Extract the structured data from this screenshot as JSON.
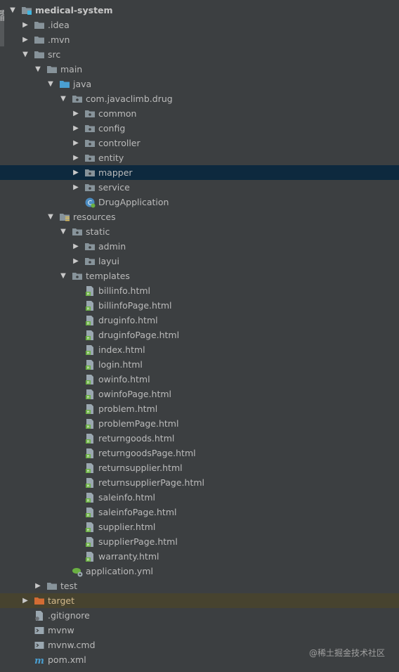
{
  "side_tab": "项目",
  "watermark": "@稀土掘金技术社区",
  "colors": {
    "background": "#3c3f41",
    "selected_row": "#0d293e",
    "excluded_row": "#47432f"
  },
  "tree": [
    {
      "label": "medical-system",
      "depth": 0,
      "arrow": "open",
      "icon": "module-folder-icon",
      "bold": true
    },
    {
      "label": ".idea",
      "depth": 1,
      "arrow": "closed",
      "icon": "folder-icon"
    },
    {
      "label": ".mvn",
      "depth": 1,
      "arrow": "closed",
      "icon": "folder-icon"
    },
    {
      "label": "src",
      "depth": 1,
      "arrow": "open",
      "icon": "folder-icon"
    },
    {
      "label": "main",
      "depth": 2,
      "arrow": "open",
      "icon": "folder-icon"
    },
    {
      "label": "java",
      "depth": 3,
      "arrow": "open",
      "icon": "source-folder-icon"
    },
    {
      "label": "com.javaclimb.drug",
      "depth": 4,
      "arrow": "open",
      "icon": "package-icon"
    },
    {
      "label": "common",
      "depth": 5,
      "arrow": "closed",
      "icon": "package-icon"
    },
    {
      "label": "config",
      "depth": 5,
      "arrow": "closed",
      "icon": "package-icon"
    },
    {
      "label": "controller",
      "depth": 5,
      "arrow": "closed",
      "icon": "package-icon"
    },
    {
      "label": "entity",
      "depth": 5,
      "arrow": "closed",
      "icon": "package-icon"
    },
    {
      "label": "mapper",
      "depth": 5,
      "arrow": "closed",
      "icon": "package-icon",
      "selected": true
    },
    {
      "label": "service",
      "depth": 5,
      "arrow": "closed",
      "icon": "package-icon"
    },
    {
      "label": "DrugApplication",
      "depth": 5,
      "arrow": "none",
      "icon": "spring-class-icon"
    },
    {
      "label": "resources",
      "depth": 3,
      "arrow": "open",
      "icon": "resources-folder-icon"
    },
    {
      "label": "static",
      "depth": 4,
      "arrow": "open",
      "icon": "package-icon"
    },
    {
      "label": "admin",
      "depth": 5,
      "arrow": "closed",
      "icon": "package-icon"
    },
    {
      "label": "layui",
      "depth": 5,
      "arrow": "closed",
      "icon": "package-icon"
    },
    {
      "label": "templates",
      "depth": 4,
      "arrow": "open",
      "icon": "package-icon"
    },
    {
      "label": "billinfo.html",
      "depth": 5,
      "arrow": "none",
      "icon": "html-file-icon"
    },
    {
      "label": "billinfoPage.html",
      "depth": 5,
      "arrow": "none",
      "icon": "html-file-icon"
    },
    {
      "label": "druginfo.html",
      "depth": 5,
      "arrow": "none",
      "icon": "html-file-icon"
    },
    {
      "label": "druginfoPage.html",
      "depth": 5,
      "arrow": "none",
      "icon": "html-file-icon"
    },
    {
      "label": "index.html",
      "depth": 5,
      "arrow": "none",
      "icon": "html-file-icon"
    },
    {
      "label": "login.html",
      "depth": 5,
      "arrow": "none",
      "icon": "html-file-icon"
    },
    {
      "label": "owinfo.html",
      "depth": 5,
      "arrow": "none",
      "icon": "html-file-icon"
    },
    {
      "label": "owinfoPage.html",
      "depth": 5,
      "arrow": "none",
      "icon": "html-file-icon"
    },
    {
      "label": "problem.html",
      "depth": 5,
      "arrow": "none",
      "icon": "html-file-icon"
    },
    {
      "label": "problemPage.html",
      "depth": 5,
      "arrow": "none",
      "icon": "html-file-icon"
    },
    {
      "label": "returngoods.html",
      "depth": 5,
      "arrow": "none",
      "icon": "html-file-icon"
    },
    {
      "label": "returngoodsPage.html",
      "depth": 5,
      "arrow": "none",
      "icon": "html-file-icon"
    },
    {
      "label": "returnsupplier.html",
      "depth": 5,
      "arrow": "none",
      "icon": "html-file-icon"
    },
    {
      "label": "returnsupplierPage.html",
      "depth": 5,
      "arrow": "none",
      "icon": "html-file-icon"
    },
    {
      "label": "saleinfo.html",
      "depth": 5,
      "arrow": "none",
      "icon": "html-file-icon"
    },
    {
      "label": "saleinfoPage.html",
      "depth": 5,
      "arrow": "none",
      "icon": "html-file-icon"
    },
    {
      "label": "supplier.html",
      "depth": 5,
      "arrow": "none",
      "icon": "html-file-icon"
    },
    {
      "label": "supplierPage.html",
      "depth": 5,
      "arrow": "none",
      "icon": "html-file-icon"
    },
    {
      "label": "warranty.html",
      "depth": 5,
      "arrow": "none",
      "icon": "html-file-icon"
    },
    {
      "label": "application.yml",
      "depth": 4,
      "arrow": "none",
      "icon": "spring-yml-icon"
    },
    {
      "label": "test",
      "depth": 2,
      "arrow": "closed",
      "icon": "folder-icon"
    },
    {
      "label": "target",
      "depth": 1,
      "arrow": "closed",
      "icon": "excluded-folder-icon",
      "excluded": true
    },
    {
      "label": ".gitignore",
      "depth": 1,
      "arrow": "none",
      "icon": "gitignore-file-icon"
    },
    {
      "label": "mvnw",
      "depth": 1,
      "arrow": "none",
      "icon": "script-file-icon"
    },
    {
      "label": "mvnw.cmd",
      "depth": 1,
      "arrow": "none",
      "icon": "script-file-icon"
    },
    {
      "label": "pom.xml",
      "depth": 1,
      "arrow": "none",
      "icon": "maven-file-icon"
    }
  ]
}
